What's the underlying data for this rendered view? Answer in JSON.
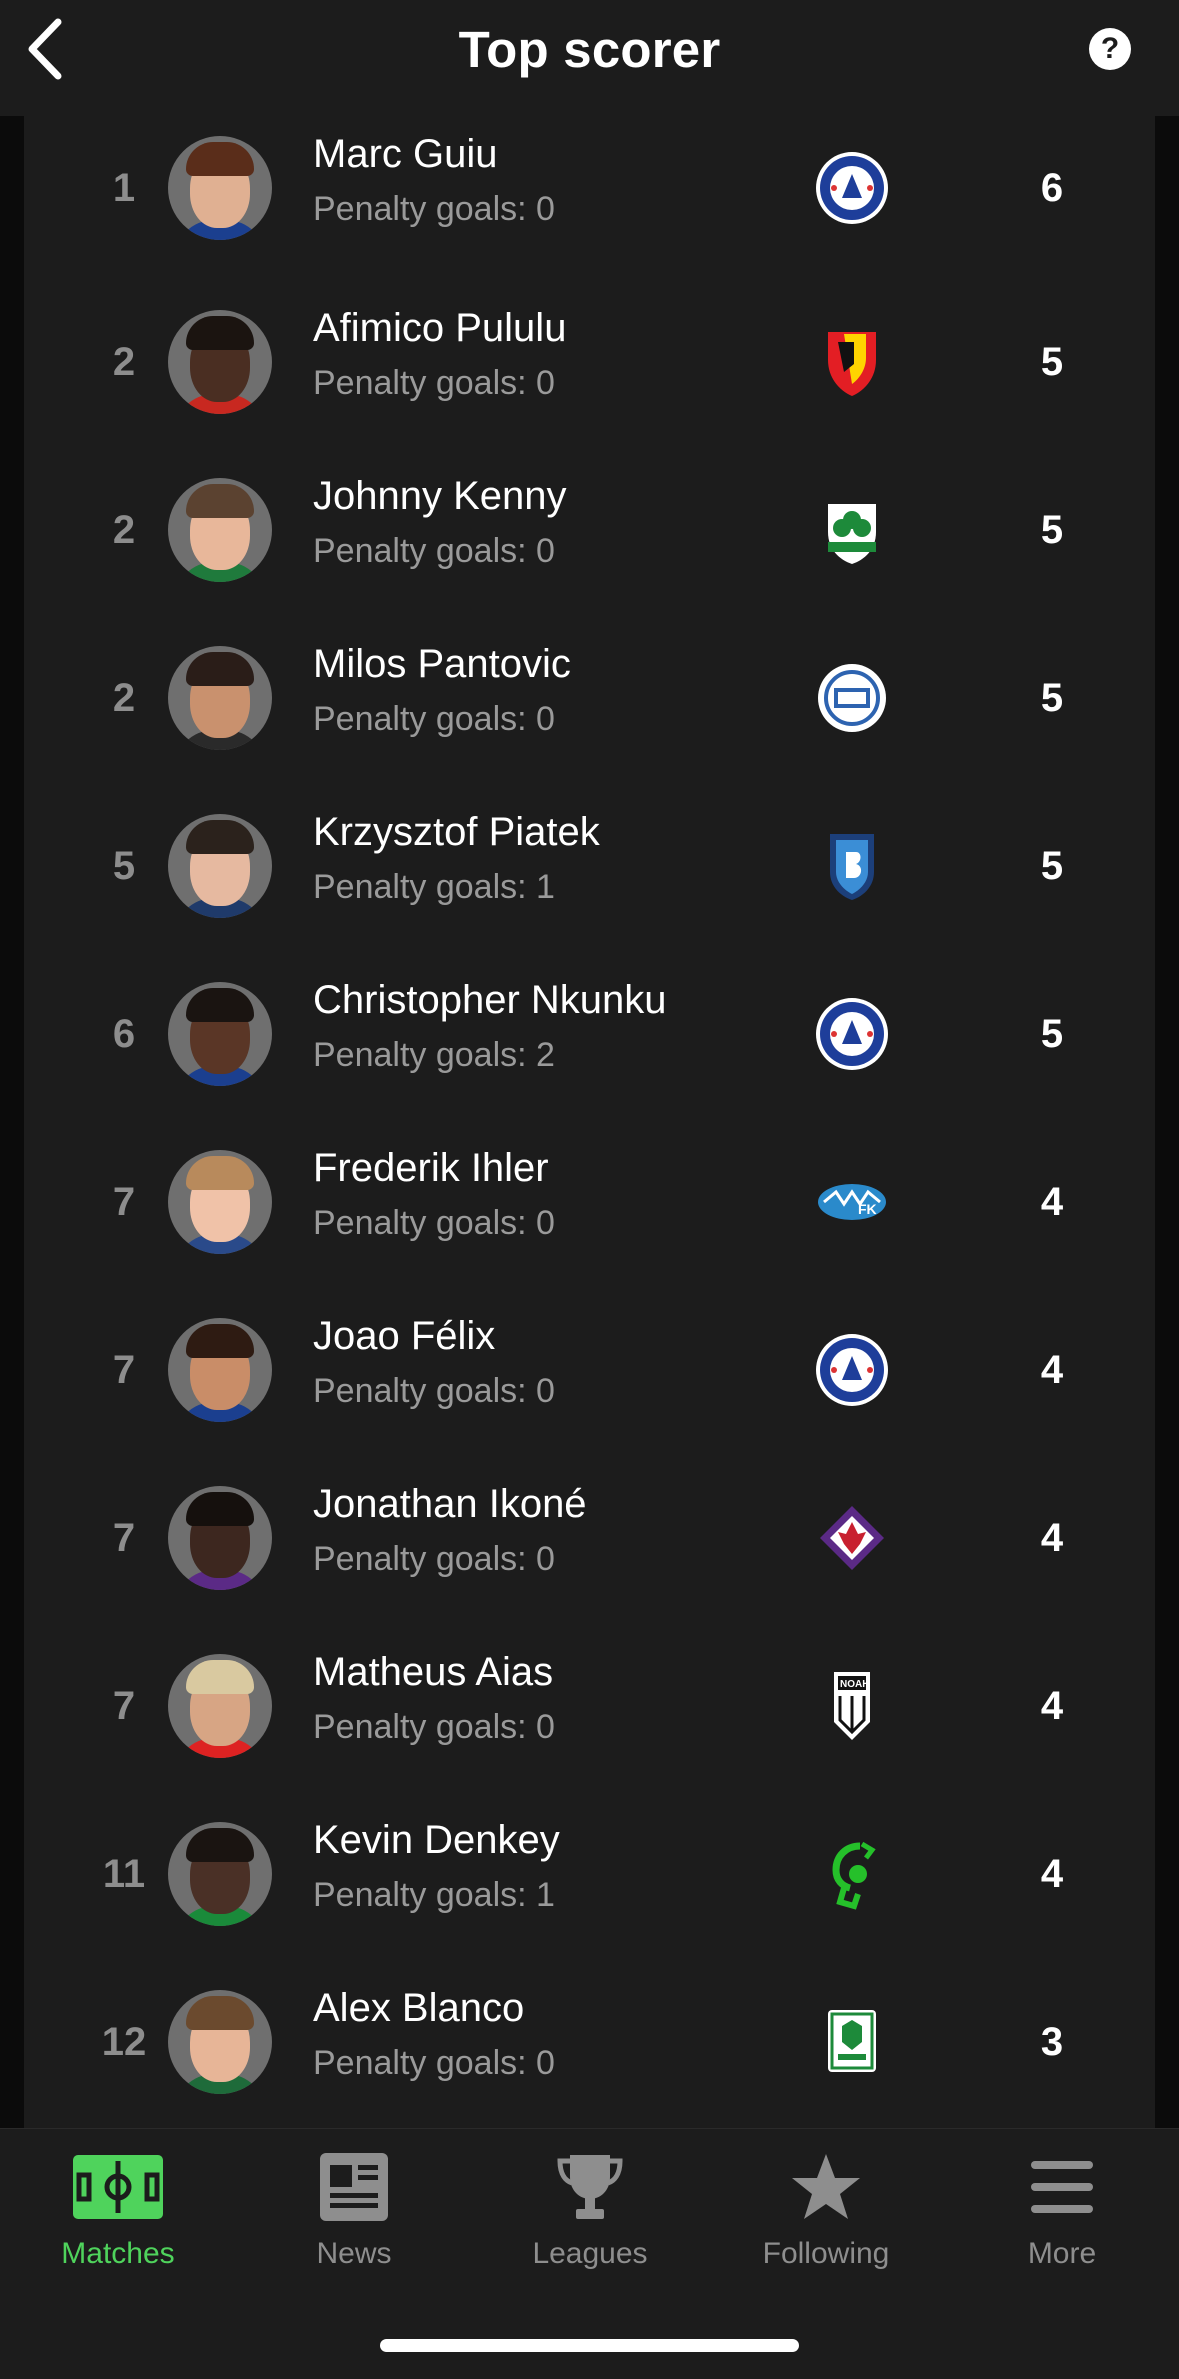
{
  "header": {
    "title": "Top scorer",
    "back_icon": "back-chevron-icon",
    "help_label": "?"
  },
  "players": [
    {
      "rank": "1",
      "name": "Marc Guiu",
      "penalty": "Penalty goals: 0",
      "goals": "6",
      "club": "Chelsea",
      "crest": "chelsea-crest-icon"
    },
    {
      "rank": "2",
      "name": "Afimico Pululu",
      "penalty": "Penalty goals: 0",
      "goals": "5",
      "club": "Jagiellonia",
      "crest": "jagiellonia-crest-icon"
    },
    {
      "rank": "2",
      "name": "Johnny Kenny",
      "penalty": "Penalty goals: 0",
      "goals": "5",
      "club": "Shamrock Rovers",
      "crest": "shamrock-rovers-crest-icon"
    },
    {
      "rank": "2",
      "name": "Milos Pantovic",
      "penalty": "Penalty goals: 0",
      "goals": "5",
      "club": "Backa Topola",
      "crest": "backa-topola-crest-icon"
    },
    {
      "rank": "5",
      "name": "Krzysztof Piatek",
      "penalty": "Penalty goals: 1",
      "goals": "5",
      "club": "Basaksehir",
      "crest": "basaksehir-crest-icon"
    },
    {
      "rank": "6",
      "name": "Christopher Nkunku",
      "penalty": "Penalty goals: 2",
      "goals": "5",
      "club": "Chelsea",
      "crest": "chelsea-crest-icon"
    },
    {
      "rank": "7",
      "name": "Frederik Ihler",
      "penalty": "Penalty goals: 0",
      "goals": "4",
      "club": "Molde",
      "crest": "molde-crest-icon"
    },
    {
      "rank": "7",
      "name": "Joao Félix",
      "penalty": "Penalty goals: 0",
      "goals": "4",
      "club": "Chelsea",
      "crest": "chelsea-crest-icon"
    },
    {
      "rank": "7",
      "name": "Jonathan Ikoné",
      "penalty": "Penalty goals: 0",
      "goals": "4",
      "club": "Fiorentina",
      "crest": "fiorentina-crest-icon"
    },
    {
      "rank": "7",
      "name": "Matheus Aias",
      "penalty": "Penalty goals: 0",
      "goals": "4",
      "club": "Noah",
      "crest": "noah-crest-icon"
    },
    {
      "rank": "11",
      "name": "Kevin Denkey",
      "penalty": "Penalty goals: 1",
      "goals": "4",
      "club": "Cercle Brugge",
      "crest": "cercle-brugge-crest-icon"
    },
    {
      "rank": "12",
      "name": "Alex Blanco",
      "penalty": "Penalty goals: 0",
      "goals": "3",
      "club": "Olimpija",
      "crest": "olimpija-crest-icon"
    }
  ],
  "tabs": [
    {
      "label": "Matches",
      "icon": "pitch-icon",
      "active": true
    },
    {
      "label": "News",
      "icon": "newspaper-icon",
      "active": false
    },
    {
      "label": "Leagues",
      "icon": "trophy-icon",
      "active": false
    },
    {
      "label": "Following",
      "icon": "star-icon",
      "active": false
    },
    {
      "label": "More",
      "icon": "menu-icon",
      "active": false
    }
  ],
  "colors": {
    "accent": "#4fd35c",
    "background": "#1c1c1c",
    "muted": "#9a9a9a"
  }
}
